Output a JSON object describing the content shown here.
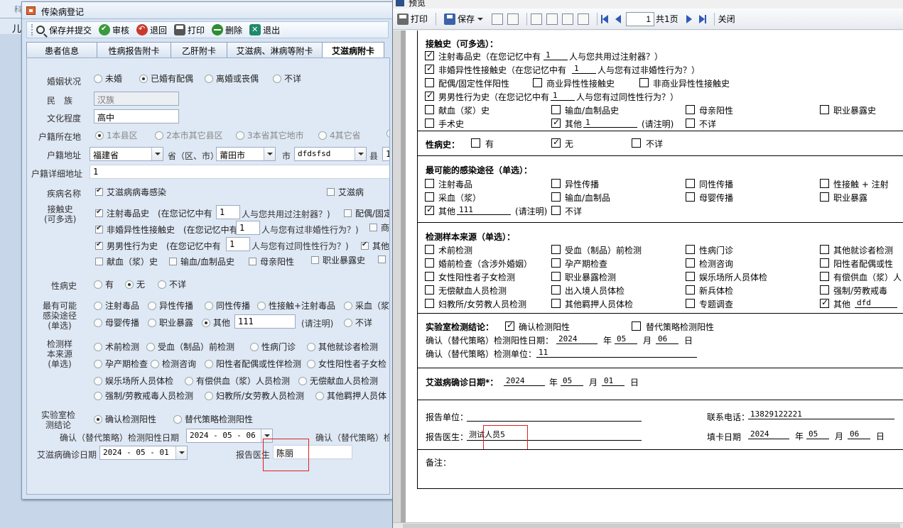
{
  "bg": {
    "items": [
      "科",
      "儿"
    ]
  },
  "left": {
    "title": "传染病登记",
    "toolbar": [
      "保存并提交",
      "审核",
      "退回",
      "打印",
      "删除",
      "退出"
    ],
    "tabs": [
      "患者信息",
      "性病报告附卡",
      "乙肝附卡",
      "艾滋病、淋病等附卡",
      "艾滋病附卡"
    ],
    "marital": {
      "label": "婚姻状况",
      "options": [
        "未婚",
        "已婚有配偶",
        "离婚或丧偶",
        "不详"
      ],
      "selected": 1
    },
    "ethnic": {
      "label": "民　族",
      "value": "汉族"
    },
    "edu": {
      "label": "文化程度",
      "value": "高中"
    },
    "hukou_loc": {
      "label": "户籍所在地",
      "options": [
        "1本县区",
        "2本市其它县区",
        "3本省其它地市",
        "4其它省"
      ]
    },
    "hukou_addr": {
      "label": "户籍地址",
      "province": "福建省",
      "sep1": "省（区、市）",
      "city": "莆田市",
      "sep2": "市",
      "county": "dfdsfsd",
      "sep3": "县",
      "extra": "1"
    },
    "hukou_detail": {
      "label": "户籍详细地址",
      "value": "1"
    },
    "disease": {
      "label": "疾病名称",
      "opt1": "艾滋病病毒感染",
      "opt2": "艾滋病"
    },
    "contact": {
      "label": "接触史\n(可多选)",
      "drug": "注射毒品史　(在您记忆中有",
      "drug_val": "1",
      "drug_tail": "人与您共用过注射器？)",
      "spouse": "配偶/固定",
      "hetero": "非婚异性性接触史　(在您记忆中有",
      "hetero_val": "1",
      "hetero_tail": "人与您有过非婚性行为？)",
      "commercial": "商",
      "homo": "男男性行为史　(在您记忆中有",
      "homo_val": "1",
      "homo_tail": "人与您有过同性性行为？)",
      "other": "其他",
      "blood": "献血（浆）史",
      "transfusion": "输血/血制品史",
      "mother": "母亲阳性",
      "occup": "职业暴露史"
    },
    "std": {
      "label": "性病史",
      "options": [
        "有",
        "无",
        "不详"
      ],
      "selected": 1
    },
    "route": {
      "label": "最有可能\n感染途径\n(单选)",
      "row1": [
        "注射毒品",
        "异性传播",
        "同性传播",
        "性接触+注射毒品",
        "采血（浆"
      ],
      "row2": [
        "母婴传播",
        "职业暴露",
        "其他"
      ],
      "other_val": "111",
      "note": "(请注明)",
      "unknown": "不详"
    },
    "sample": {
      "label": "检测样\n本来源\n(单选)",
      "row1": [
        "术前检测",
        "受血（制品）前检测",
        "性病门诊",
        "其他就诊者检测"
      ],
      "row2": [
        "孕产期检查",
        "检测咨询",
        "阳性者配偶或性伴检测",
        "女性阳性者子女检"
      ],
      "row3": [
        "娱乐场所人员体检",
        "有偿供血（浆）人员检测",
        "无偿献血人员检测"
      ],
      "row4": [
        "强制/劳教戒毒人员检测",
        "妇教所/女劳教人员检测",
        "其他羁押人员体"
      ]
    },
    "lab": {
      "label": "实验室检\n测结论",
      "opt1": "确认检测阳性",
      "opt2": "替代策略检测阳性"
    },
    "confirm_date": {
      "label": "确认（替代策略）检测阳性日期",
      "value": "2024 - 05 - 06",
      "unit_label": "确认（替代策略）检"
    },
    "diag_date": {
      "label": "艾滋病确诊日期",
      "value": "2024 - 05 - 01"
    },
    "doctor": {
      "label": "报告医生",
      "value": "陈丽"
    }
  },
  "right": {
    "title": "预览",
    "toolbar": {
      "print": "打印",
      "save": "保存",
      "page": "1",
      "total": "共1页",
      "close": "关闭"
    },
    "contact": {
      "title": "接触史（可多选）：",
      "drug": "注射毒品史（在您记忆中有",
      "drug_val": "1",
      "drug_tail": "人与您共用过注射器？）",
      "hetero": "非婚异性性接触史（在您记忆中有",
      "hetero_val": "1",
      "hetero_tail": "人与您有过非婚性行为？）",
      "spouse": "配偶/固定性伴阳性",
      "commercial": "商业异性性接触史",
      "noncommercial": "非商业异性性接触史",
      "homo": "男男性行为史（在您记忆中有",
      "homo_val": "1",
      "homo_tail": "人与您有过同性性行为？）",
      "blood": "献血（浆）史",
      "transfusion": "输血/血制品史",
      "mother": "母亲阳性",
      "occup": "职业暴露史",
      "surgery": "手术史",
      "other": "其他",
      "other_val": "1",
      "note": "(请注明)",
      "unknown": "不详"
    },
    "std": {
      "title": "性病史：",
      "yes": "有",
      "no": "无",
      "unknown": "不详"
    },
    "route": {
      "title": "最可能的感染途径（单选）：",
      "row1": [
        "注射毒品",
        "异性传播",
        "同性传播",
        "性接触 + 注射"
      ],
      "row2": [
        "采血（浆）",
        "输血/血制品",
        "母婴传播",
        "职业暴露"
      ],
      "other": "其他",
      "other_val": "111",
      "note": "(请注明)",
      "unknown": "不详"
    },
    "sample": {
      "title": "检测样本来源（单选）：",
      "rows": [
        [
          "术前检测",
          "受血（制品）前检测",
          "性病门诊",
          "其他就诊者检测"
        ],
        [
          "婚前检查（含涉外婚姻）",
          "孕产期检查",
          "检测咨询",
          "阳性者配偶或性"
        ],
        [
          "女性阳性者子女检测",
          "职业暴露检测",
          "娱乐场所人员体检",
          "有偿供血（浆）人"
        ],
        [
          "无偿献血人员检测",
          "出入境人员体检",
          "新兵体检",
          "强制/劳教戒毒"
        ],
        [
          "妇教所/女劳教人员检测",
          "其他羁押人员体检",
          "专题调查",
          "其他"
        ]
      ],
      "other_val": "dfd"
    },
    "lab": {
      "title": "实验室检测结论：",
      "opt1": "确认检测阳性",
      "opt2": "替代策略检测阳性",
      "date_label": "确认（替代策略）检测阳性日期：",
      "year": "2024",
      "month": "05",
      "day": "06",
      "unit_label": "确认（替代策略）检测单位：",
      "unit": "11"
    },
    "diag": {
      "title": "艾滋病确诊日期*：",
      "year": "2024",
      "month": "05",
      "day": "01"
    },
    "units": {
      "y": "年",
      "m": "月",
      "d": "日"
    },
    "report": {
      "unit_label": "报告单位：",
      "phone_label": "联系电话：",
      "phone": "13829122221",
      "doctor_label": "报告医生：",
      "doctor": "测试人员5",
      "fill_label": "填卡日期",
      "fill_year": "2024",
      "fill_month": "05",
      "fill_day": "06",
      "remark_label": "备注："
    }
  }
}
